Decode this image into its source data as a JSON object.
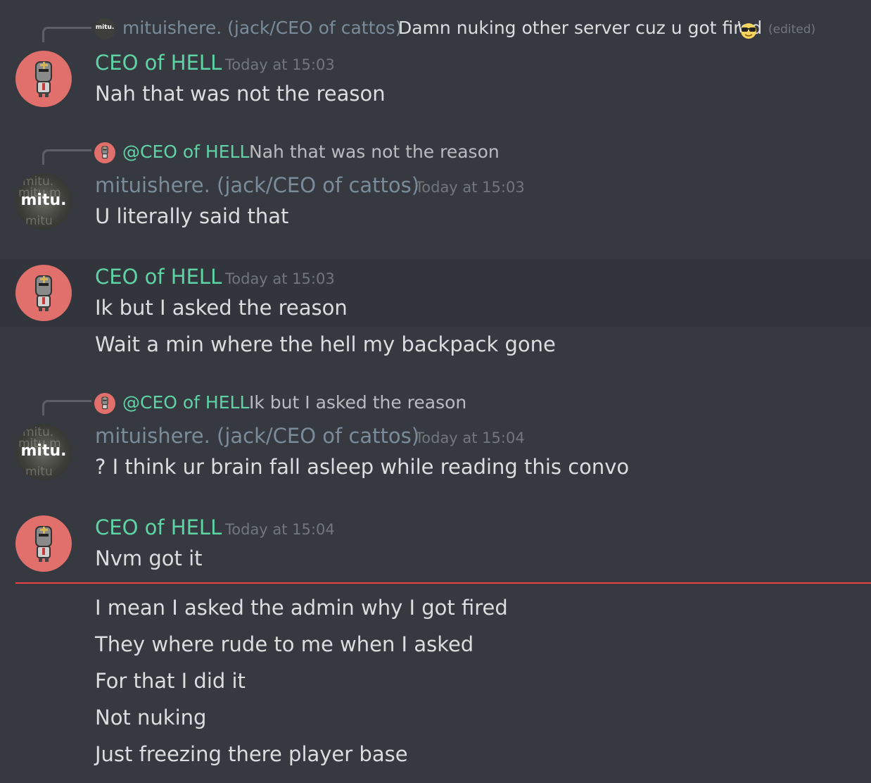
{
  "messages": [
    {
      "reply": {
        "author": "mituishere. (jack/CEO of cattos)",
        "text": "Damn nuking other server cuz u got fired",
        "edited": "(edited)",
        "avatar_text": "mitu."
      },
      "author": "CEO of HELL",
      "timestamp": "Today at 15:03",
      "lines": [
        "Nah that was not the reason"
      ]
    },
    {
      "reply": {
        "author": "@CEO of HELL",
        "text": "Nah that was not the reason"
      },
      "author": "mituishere. (jack/CEO of cattos)",
      "timestamp": "Today at 15:03",
      "avatar_text": "mitu.",
      "lines": [
        "U literally said that"
      ]
    },
    {
      "author": "CEO of HELL",
      "timestamp": "Today at 15:03",
      "lines": [
        "Ik but I asked the reason",
        "Wait a min where the hell my backpack gone"
      ]
    },
    {
      "reply": {
        "author": "@CEO of HELL",
        "text": "Ik but I asked the reason"
      },
      "author": "mituishere. (jack/CEO of cattos)",
      "timestamp": "Today at 15:04",
      "avatar_text": "mitu.",
      "lines": [
        "? I think ur brain fall asleep while reading this convo"
      ]
    },
    {
      "author": "CEO of HELL",
      "timestamp": "Today at 15:04",
      "lines": [
        "Nvm got it"
      ]
    }
  ],
  "new_messages": [
    "I mean I asked the admin why I got fired",
    "They where rude to me when I asked",
    "For that I did it",
    "Not nuking",
    "Just freezing there player base"
  ],
  "icons": {
    "avatar_ceo": "knight-helmet-icon",
    "emoji": "sunglasses-emoji-icon"
  },
  "colors": {
    "background": "#36393f",
    "ceo_name": "#5fd3a5",
    "mitu_name": "#7a8b99",
    "new_divider": "#ed4245"
  }
}
